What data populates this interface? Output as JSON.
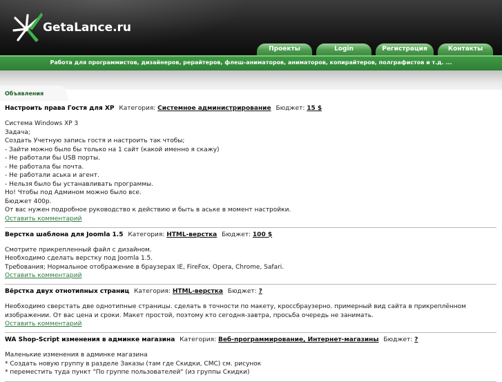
{
  "header": {
    "logo_text": "GetaLance.ru",
    "nav": [
      "Проекты",
      "Login",
      "Регистрация",
      "Контакты"
    ],
    "tagline": "Работа для программистов, дизайнеров, рерайтеров, флеш-аниматоров, аниматоров, копирайтеров, полграфистов и т.д. ..."
  },
  "section_label": "Объявления",
  "labels": {
    "category": "Категория:",
    "budget": "Бюджет:",
    "comment": "Оставить комментарий"
  },
  "items": [
    {
      "title": "Настроить права Гостя для XP",
      "category": "Системное администрирование",
      "budget": "15 $",
      "lines": [
        "Система Windows XP 3",
        "Задача;",
        "Создать Учетную запись гостя и настроить так чтобы;",
        "- Зайти можно было бы только на 1 сайт (какой именно я скажу)",
        "- Не работали бы USB порты.",
        "- Не работала бы почта.",
        "- Не работали аська и агент.",
        "- Нельзя было бы устанавливать программы.",
        "Но! Чтобы под Админом можно было все.",
        "Бюджет 400р.",
        "От вас нужен подробное руководство к действию и быть в аське в момент настройки."
      ]
    },
    {
      "title": "Верстка шаблона для Joomla 1.5",
      "category": "HTML-верстка",
      "budget": "100 $",
      "lines": [
        "Смотрите прикрепленный файл с дизайном.",
        "Необходимо сделать верстку под Joomla 1.5.",
        "Требования; Нормальное отображение в браузерах IE, FireFox, Opera, Chrome, Safari."
      ]
    },
    {
      "title": "Вёрстка двух отнотипных страниц",
      "category": "HTML-верстка",
      "budget": "?",
      "lines": [
        "Необходимо сверстать две однотипные страницы. сделать в точности по макету, кроссбраузерно. примерный вид сайта в прикреплённом изображении. От вас цена и сроки. Макет простой, поэтому кто сегодня-завтра, просьба очередь не занимать."
      ]
    },
    {
      "title": "WA Shop-Script изменения в админке магазина",
      "category": "Веб-программирование, Интернет-магазины",
      "budget": "?",
      "lines": [
        "Маленькие изменения в админке магазина",
        "* Создать новую группу в разделе Заказы (там где Скидки, СМС) см. рисунок",
        "* переместить туда пункт \"По группе пользователей\" (из группы Скидки)"
      ]
    }
  ]
}
